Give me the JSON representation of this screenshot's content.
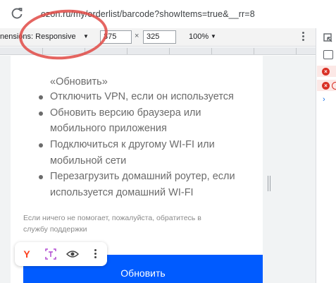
{
  "address_bar": {
    "url": "ozon.ru/my/orderlist/barcode?showItems=true&__rr=8"
  },
  "device_toolbar": {
    "dimensions_label": "nensions: Responsive",
    "width_value": "375",
    "times": "×",
    "height_value": "325",
    "zoom": "100%"
  },
  "page": {
    "lines": [
      "«Обновить»",
      "Отключить VPN, если он используется",
      "Обновить версию браузера или",
      "мобильного приложения",
      "Подключиться к другому WI-FI или",
      "мобильной сети",
      "Перезагрузить домашний роутер, если",
      "используется домашний WI-FI"
    ],
    "help_lines": [
      "Если ничего не помогает, пожалуйста, обратитесь в",
      "службу поддержки"
    ],
    "refresh_button": "Обновить"
  },
  "float_toolbar": {
    "yandex_letter": "Y"
  },
  "colors": {
    "accent_button": "#005bff",
    "annotation": "#e04a45",
    "error": "#d93025"
  }
}
